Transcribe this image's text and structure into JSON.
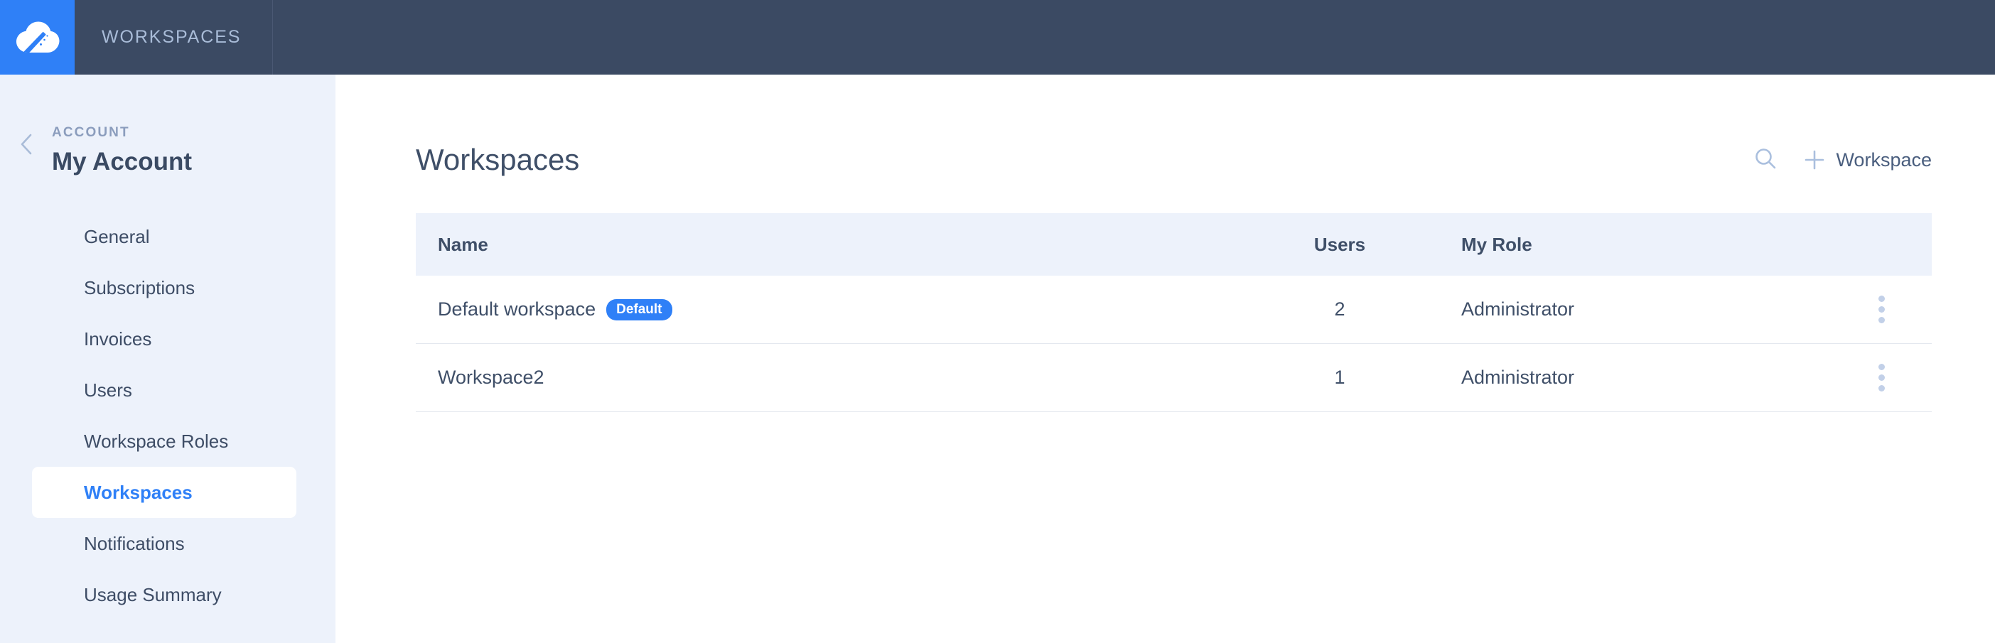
{
  "topbar": {
    "logo_icon": "cloud-logo-icon",
    "title": "WORKSPACES",
    "brand_color": "#2f80f7",
    "bar_color": "#3b4a63"
  },
  "sidebar": {
    "back_icon": "chevron-left-icon",
    "section_label": "ACCOUNT",
    "account_name": "My Account",
    "items": [
      {
        "label": "General",
        "active": false
      },
      {
        "label": "Subscriptions",
        "active": false
      },
      {
        "label": "Invoices",
        "active": false
      },
      {
        "label": "Users",
        "active": false
      },
      {
        "label": "Workspace Roles",
        "active": false
      },
      {
        "label": "Workspaces",
        "active": true
      },
      {
        "label": "Notifications",
        "active": false
      },
      {
        "label": "Usage Summary",
        "active": false
      }
    ],
    "active_color": "#2f80f7"
  },
  "main": {
    "page_title": "Workspaces",
    "search_icon": "search-icon",
    "add_icon": "plus-icon",
    "add_label": "Workspace",
    "table": {
      "columns": [
        "Name",
        "Users",
        "My Role"
      ],
      "rows": [
        {
          "name": "Default workspace",
          "badge": "Default",
          "users": "2",
          "role": "Administrator",
          "menu_icon": "kebab-menu-icon"
        },
        {
          "name": "Workspace2",
          "badge": "",
          "users": "1",
          "role": "Administrator",
          "menu_icon": "kebab-menu-icon"
        }
      ]
    }
  }
}
